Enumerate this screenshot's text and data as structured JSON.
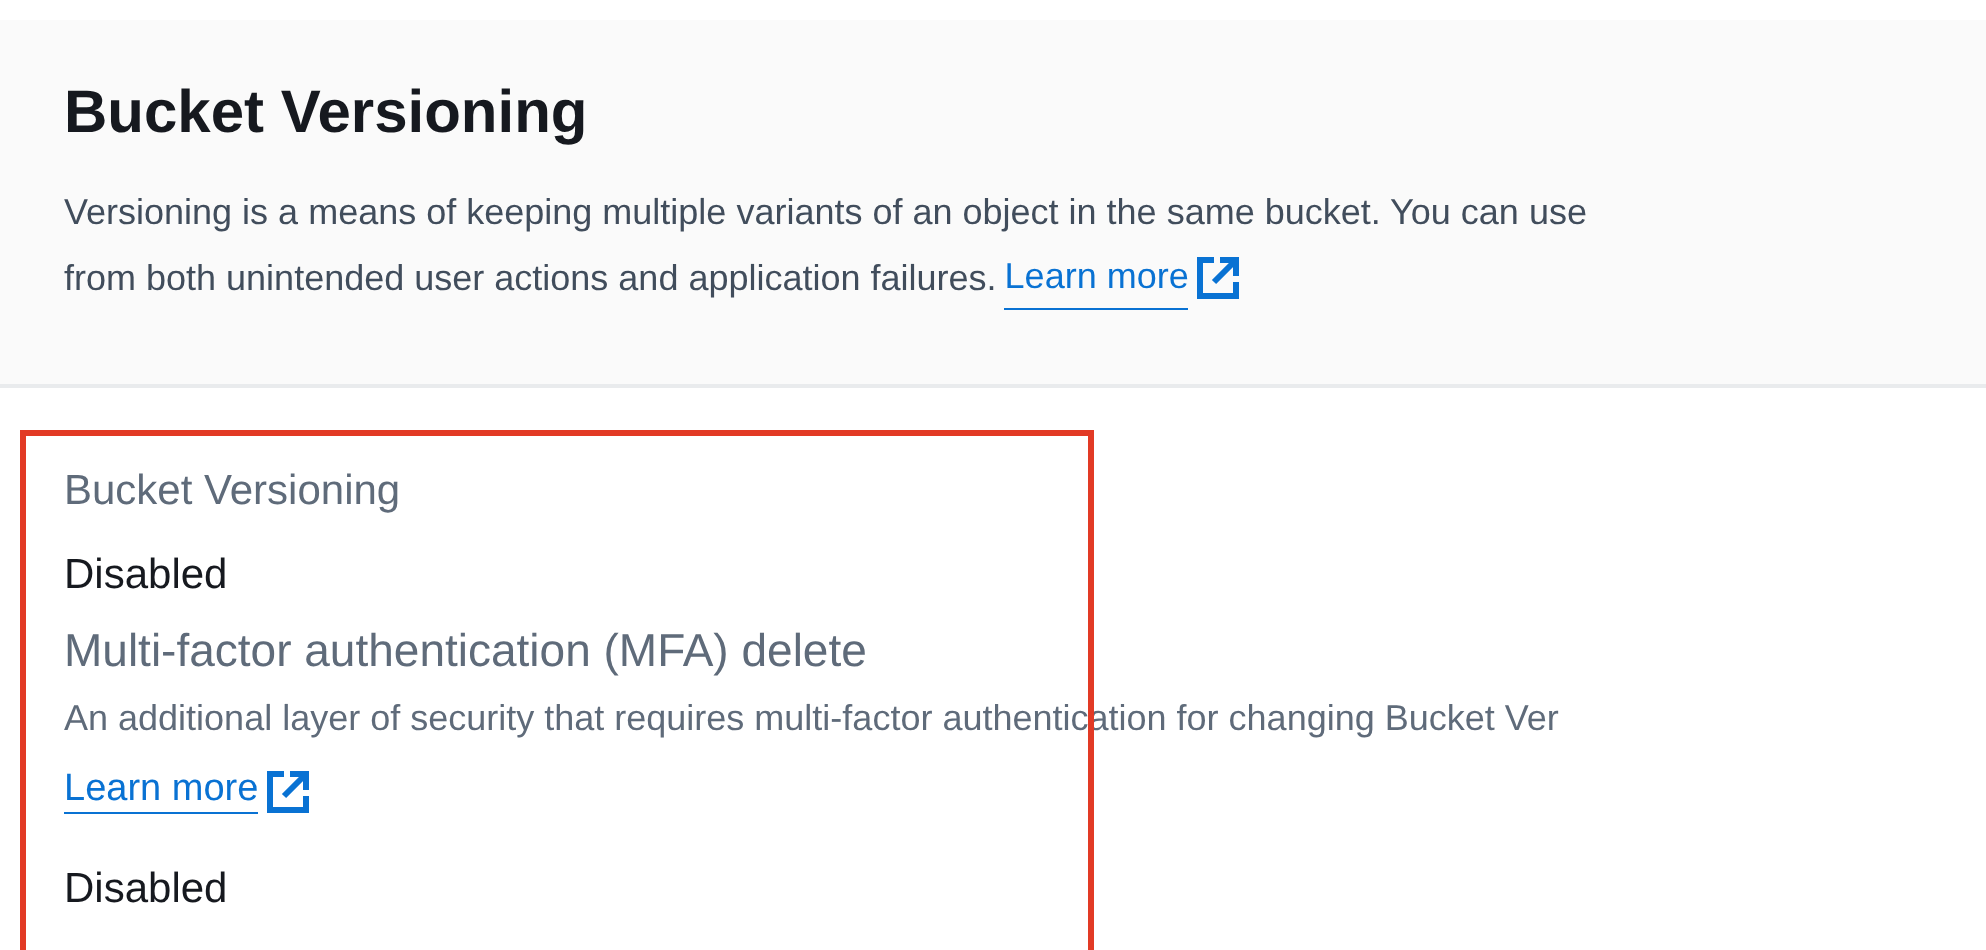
{
  "header": {
    "title": "Bucket Versioning",
    "description": "Versioning is a means of keeping multiple variants of an object in the same bucket. You can use",
    "description_cont": "from both unintended user actions and application failures.",
    "link": "Learn more"
  },
  "details": {
    "label": "Bucket Versioning",
    "status": "Disabled",
    "mfa_title": "Multi-factor authentication (MFA) delete",
    "mfa_description": "An additional layer of security that requires multi-factor authentication for changing Bucket Ver",
    "link": "Learn more",
    "mfa_status": "Disabled"
  }
}
